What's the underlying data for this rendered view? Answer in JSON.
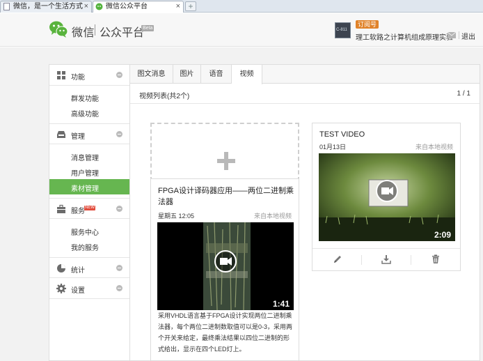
{
  "browser": {
    "tabs": [
      {
        "label": "微信，是一个生活方式",
        "active": false
      },
      {
        "label": "微信公众平台",
        "active": true
      }
    ]
  },
  "header": {
    "logo_text": "微信",
    "logo_sub": "公众平台",
    "beta": "Beta",
    "account_badge": "订阅号",
    "account_name": "理工软路之计算机组成原理实验",
    "avatar_text": "C-811",
    "logout": "退出"
  },
  "sidebar": {
    "sections": [
      {
        "label": "功能",
        "icon": "grid-icon",
        "items": [
          "群发功能",
          "高级功能"
        ]
      },
      {
        "label": "管理",
        "icon": "inbox-icon",
        "items": [
          "消息管理",
          "用户管理",
          "素材管理"
        ]
      },
      {
        "label": "服务",
        "icon": "briefcase-icon",
        "badge": "NEW",
        "items": [
          "服务中心",
          "我的服务"
        ]
      },
      {
        "label": "统计",
        "icon": "pie-chart-icon",
        "items": []
      },
      {
        "label": "设置",
        "icon": "gear-icon",
        "items": []
      }
    ],
    "active_item": "素材管理"
  },
  "main": {
    "tabs": [
      "图文消息",
      "图片",
      "语音",
      "视频"
    ],
    "active_tab": "视频",
    "list_title": "视频列表(共2个)",
    "pager": "1 / 1"
  },
  "videos": [
    {
      "title": "FPGA设计译码器应用——两位二进制乘法器",
      "time": "星期五 12:05",
      "source": "来自本地视频",
      "duration": "1:41",
      "description": "采用VHDL语言基于FPGA设计实现两位二进制乘法器，每个两位二进制数取值可以是0-3，采用两个开关来给定，最终乘法结果以四位二进制的形式给出，显示在四个LED灯上。"
    },
    {
      "title": "TEST VIDEO",
      "time": "01月13日",
      "source": "来自本地视频",
      "duration": "2:09"
    }
  ],
  "colors": {
    "accent_green": "#66b650",
    "badge_orange": "#e0832a",
    "new_badge_red": "#e24c3c"
  }
}
